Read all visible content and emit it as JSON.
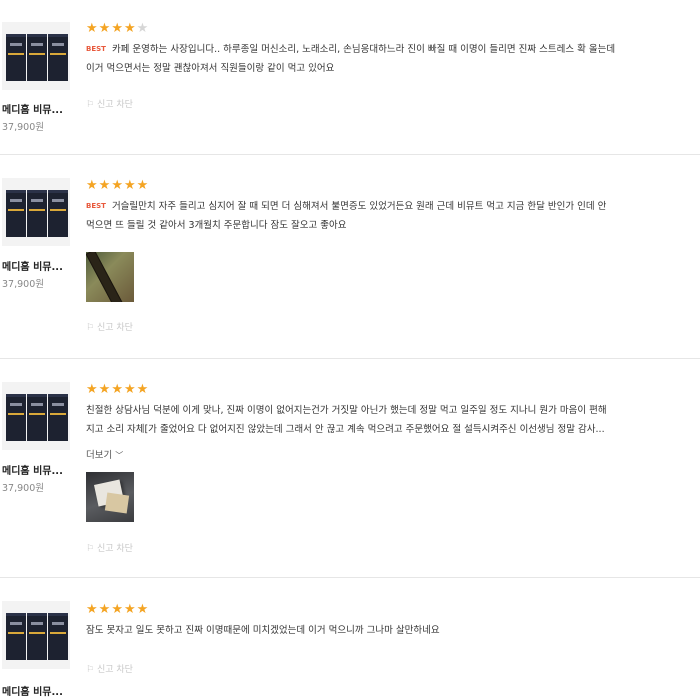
{
  "product": {
    "name": "메디홈 비뮤...",
    "price": "37,900원"
  },
  "labels": {
    "best": "BEST",
    "report": "신고 차단",
    "more": "더보기"
  },
  "colors": {
    "star": "#f4a423",
    "star_empty": "#d6d6d6",
    "best": "#e8593c"
  },
  "reviews": [
    {
      "rating": 4,
      "best": true,
      "has_photo": false,
      "has_more": false,
      "line1": "카페 운영하는 사장입니다.. 하루종일 머신소리, 노래소리, 손님응대하느라 진이 빠질 때 이명이 들리면 진짜 스트레스 확 올는데",
      "line2": "이거 먹으면서는 정말 괜찮아져서 직원들이랑 같이 먹고 있어요"
    },
    {
      "rating": 5,
      "best": true,
      "has_photo": true,
      "has_more": false,
      "line1": "거슬릴만치 자주 들리고 심지어 잘 때 되면 더 심해져서 불면증도 있었거든요 원래 근데 비뮤트 먹고 지금 한달 반인가 인데 안",
      "line2": "먹으면 뜨 들릴 것 같아서 3개월치 주문합니다 잠도 잘오고 좋아요"
    },
    {
      "rating": 5,
      "best": false,
      "has_photo": true,
      "has_more": true,
      "line1": "친절한 상담사님 덕분에 이게 맞나, 진짜 이명이 없어지는건가 거짓말 아닌가 했는데 정말 먹고 일주일 정도 지나니 뭔가 마음이 편해",
      "line2": "지고 소리 자체[가 줄었어요 다 없어지진 않았는데 그래서 안 끊고 계속 먹으려고 주문했어요 절 설득시켜주신 이선생님 정말 감사..."
    },
    {
      "rating": 5,
      "best": false,
      "has_photo": false,
      "has_more": false,
      "line1": "잠도 못자고 일도 못하고 진짜 이명때문에 미치겠었는데 이거 먹으니까 그나마 살만하네요",
      "line2": ""
    }
  ]
}
